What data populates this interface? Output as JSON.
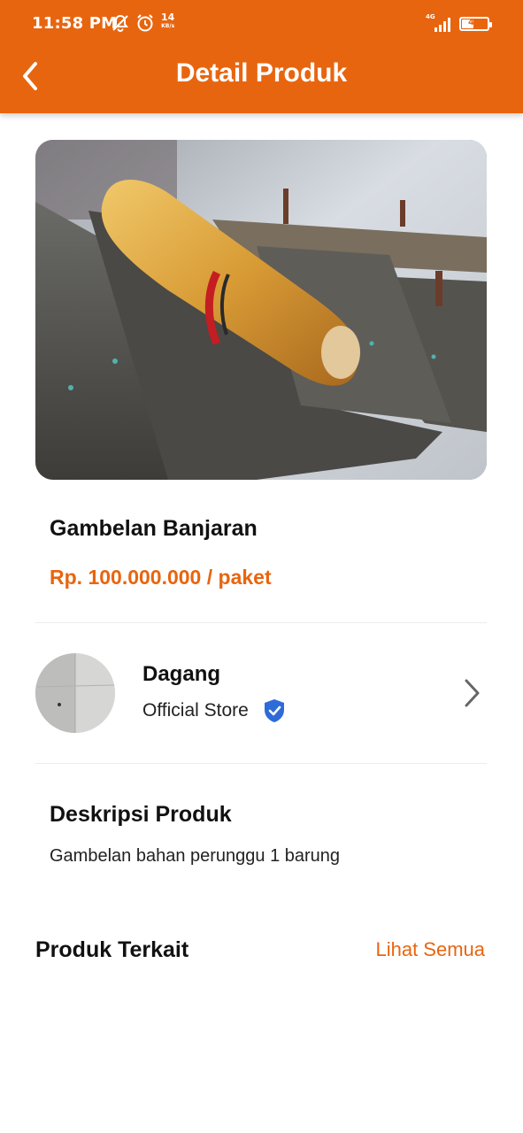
{
  "status_bar": {
    "time": "11:58 PM",
    "net_speed_value": "14",
    "net_speed_unit": "KB/s",
    "network": "4G",
    "battery": "46",
    "battery_level": 0.46,
    "icons": [
      "mute-notification-icon",
      "alarm-icon",
      "signal-icon",
      "battery-icon"
    ]
  },
  "header": {
    "title": "Detail Produk",
    "back_icon": "chevron-left-icon",
    "background_color": "#E8650F"
  },
  "product": {
    "name": "Gambelan Banjaran",
    "price": "Rp. 100.000.000 / paket",
    "image": "product-photo"
  },
  "store": {
    "name": "Dagang",
    "type": "Official Store",
    "verified_icon": "verified-badge-icon",
    "chevron_icon": "chevron-right-icon"
  },
  "description": {
    "title": "Deskripsi Produk",
    "text": "Gambelan bahan perunggu 1 barung"
  },
  "related": {
    "title": "Produk Terkait",
    "see_all": "Lihat Semua"
  },
  "colors": {
    "accent": "#E8650F",
    "verified": "#2F6BD8"
  }
}
